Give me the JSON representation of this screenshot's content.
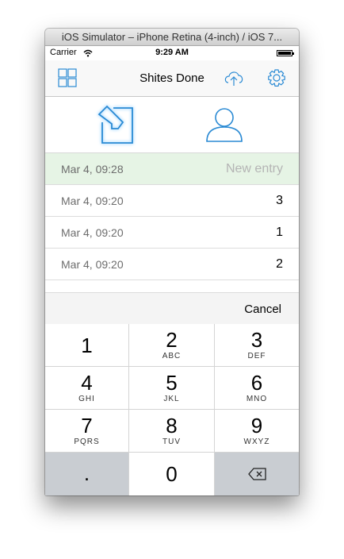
{
  "window": {
    "title": "iOS Simulator – iPhone Retina (4-inch) / iOS 7..."
  },
  "status": {
    "carrier": "Carrier",
    "time": "9:29 AM"
  },
  "nav": {
    "title": "Shites Done"
  },
  "entries": [
    {
      "date": "Mar 4, 09:28",
      "value": "New entry"
    },
    {
      "date": "Mar 4, 09:20",
      "value": "3"
    },
    {
      "date": "Mar 4, 09:20",
      "value": "1"
    },
    {
      "date": "Mar 4, 09:20",
      "value": "2"
    }
  ],
  "toolbar": {
    "cancel": "Cancel"
  },
  "keypad": {
    "keys": [
      {
        "num": "1",
        "letters": ""
      },
      {
        "num": "2",
        "letters": "ABC"
      },
      {
        "num": "3",
        "letters": "DEF"
      },
      {
        "num": "4",
        "letters": "GHI"
      },
      {
        "num": "5",
        "letters": "JKL"
      },
      {
        "num": "6",
        "letters": "MNO"
      },
      {
        "num": "7",
        "letters": "PQRS"
      },
      {
        "num": "8",
        "letters": "TUV"
      },
      {
        "num": "9",
        "letters": "WXYZ"
      },
      {
        "num": ".",
        "letters": ""
      },
      {
        "num": "0",
        "letters": ""
      }
    ]
  },
  "colors": {
    "accent": "#2a8ad4",
    "new_row_bg": "#e6f4e5",
    "key_gray": "#c9cdd2"
  },
  "icons": [
    "grid-icon",
    "cloud-upload-icon",
    "gear-icon",
    "edit-icon",
    "person-icon",
    "delete-icon",
    "wifi-icon",
    "battery-icon"
  ]
}
